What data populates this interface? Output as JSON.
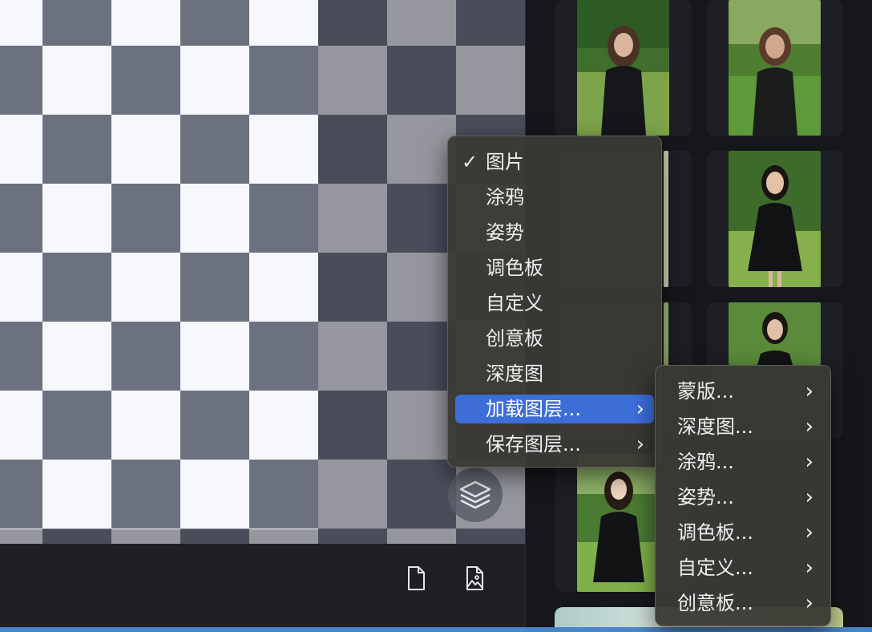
{
  "layer_menu": {
    "items": [
      {
        "label": "图片",
        "checked": true,
        "submenu": false
      },
      {
        "label": "涂鸦",
        "checked": false,
        "submenu": false
      },
      {
        "label": "姿势",
        "checked": false,
        "submenu": false
      },
      {
        "label": "调色板",
        "checked": false,
        "submenu": false
      },
      {
        "label": "自定义",
        "checked": false,
        "submenu": false
      },
      {
        "label": "创意板",
        "checked": false,
        "submenu": false
      },
      {
        "label": "深度图",
        "checked": false,
        "submenu": false
      },
      {
        "label": "加载图层...",
        "checked": false,
        "submenu": true,
        "highlighted": true
      },
      {
        "label": "保存图层...",
        "checked": false,
        "submenu": true
      }
    ],
    "check_glyph": "✓",
    "chevron_glyph": "›"
  },
  "load_layer_submenu": {
    "items": [
      {
        "label": "蒙版..."
      },
      {
        "label": "深度图..."
      },
      {
        "label": "涂鸦..."
      },
      {
        "label": "姿势..."
      },
      {
        "label": "调色板..."
      },
      {
        "label": "自定义..."
      },
      {
        "label": "创意板..."
      }
    ]
  },
  "toolbar": {
    "icons": [
      "new-file-icon",
      "image-file-icon",
      "layers-icon"
    ]
  },
  "colors": {
    "highlight": "#3d6ed8",
    "menu_bg": "#3a3934",
    "checker_dark": "#6c7180",
    "checker_light": "#f7f8fb",
    "accent_strip": "#4a86c6"
  }
}
